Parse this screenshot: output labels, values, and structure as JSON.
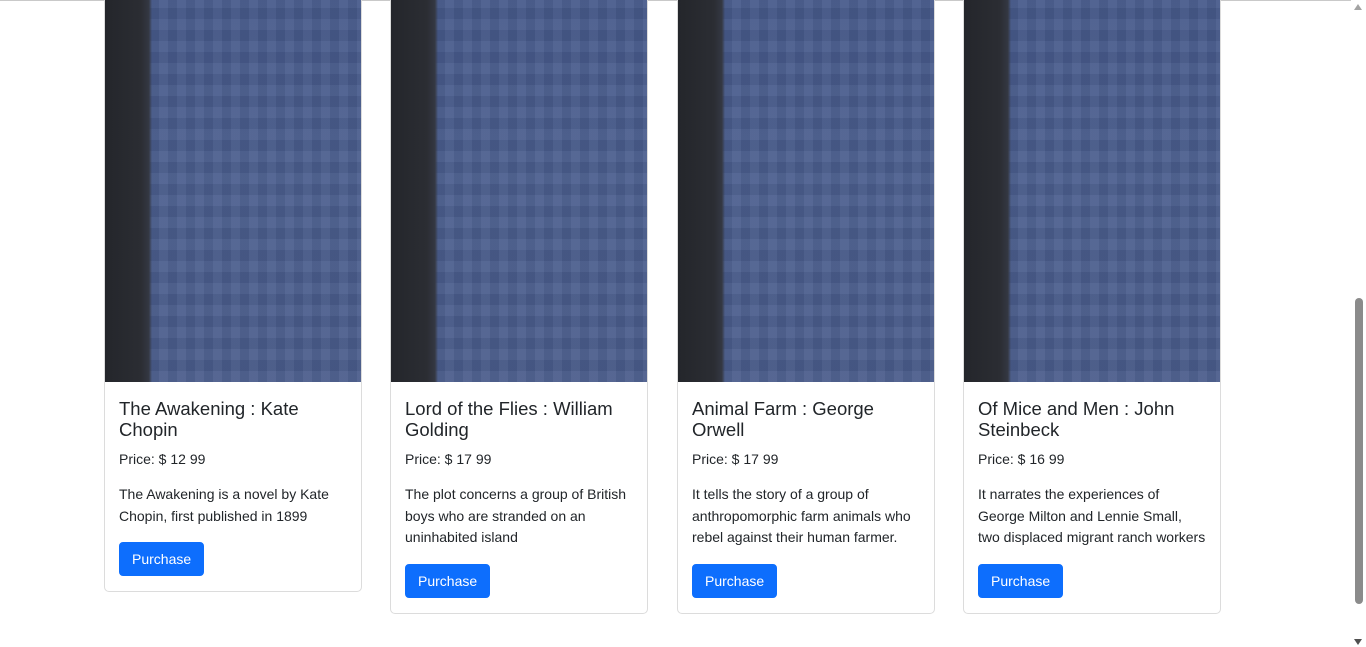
{
  "books": [
    {
      "title": "The Awakening : Kate Chopin",
      "price": "Price: $ 12 99",
      "description": "The Awakening is a novel by Kate Chopin, first published in 1899",
      "button": "Purchase"
    },
    {
      "title": "Lord of the Flies : William Golding",
      "price": "Price: $ 17 99",
      "description": "The plot concerns a group of British boys who are stranded on an uninhabited island",
      "button": "Purchase"
    },
    {
      "title": "Animal Farm : George Orwell",
      "price": "Price: $ 17 99",
      "description": "It tells the story of a group of anthropomorphic farm animals who rebel against their human farmer.",
      "button": "Purchase"
    },
    {
      "title": "Of Mice and Men : John Steinbeck",
      "price": "Price: $ 16 99",
      "description": "It narrates the experiences of George Milton and Lennie Small, two displaced migrant ranch workers",
      "button": "Purchase"
    }
  ],
  "colors": {
    "button": "#0d6efd",
    "cover": "#4a5d8c",
    "spine": "#2b2d33"
  }
}
